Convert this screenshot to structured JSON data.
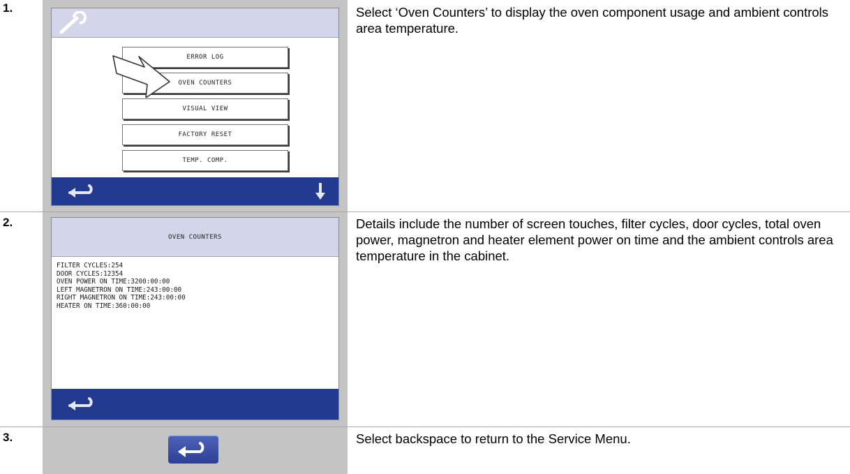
{
  "steps": [
    {
      "number": "1.",
      "description": "Select ‘Oven Counters’ to display the oven component usage and ambient controls area temperature.",
      "screen": {
        "header_icon": "wrench-icon",
        "menu_items": [
          "ERROR LOG",
          "OVEN COUNTERS",
          "VISUAL VIEW",
          "FACTORY RESET",
          "TEMP. COMP."
        ],
        "pointer_icon": "arrow-pointer-icon",
        "footer_left_icon": "back-arrow-icon",
        "footer_right_icon": "down-arrow-icon"
      }
    },
    {
      "number": "2.",
      "description": "Details include the number of screen touches, filter cycles, door cycles, total oven power, magnetron and heater element power on time and the ambient controls area temperature in the cabinet.",
      "screen": {
        "title": "OVEN COUNTERS",
        "lines": [
          "FILTER CYCLES:254",
          "DOOR CYCLES:12354",
          "OVEN POWER ON TIME:3200:00:00",
          "LEFT MAGNETRON ON TIME:243:00:00",
          "RIGHT MAGNETRON ON TIME:243:00:00",
          "HEATER ON TIME:360:00:00"
        ],
        "footer_left_icon": "back-arrow-icon"
      }
    },
    {
      "number": "3.",
      "description": "Select backspace to return to the Service Menu.",
      "button_icon": "back-arrow-icon"
    }
  ],
  "colors": {
    "panel_gray": "#c4c4c4",
    "header_lavender": "#d3d6e8",
    "footer_blue": "#233a91"
  }
}
